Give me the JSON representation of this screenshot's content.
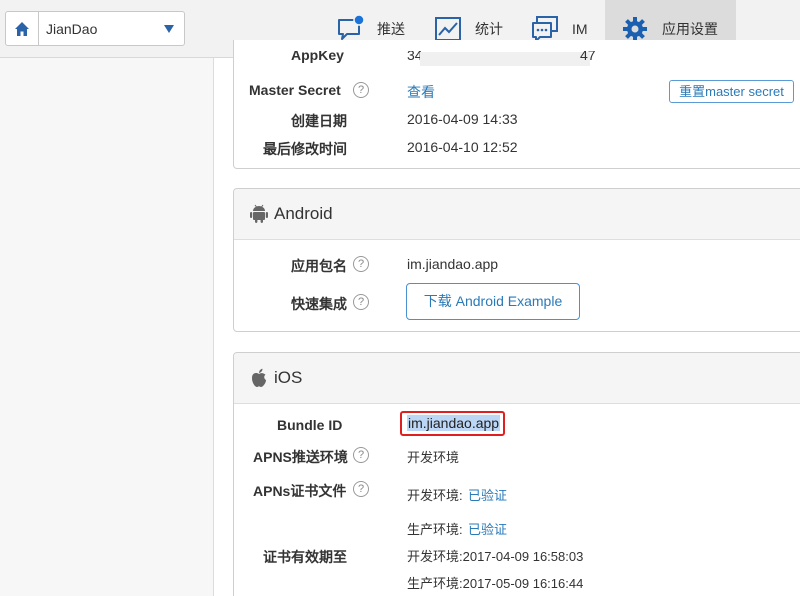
{
  "app_selector": {
    "app_name": "JianDao"
  },
  "nav": {
    "push": "推送",
    "stats": "统计",
    "im": "IM",
    "settings": "应用设置"
  },
  "app_info": {
    "appkey_label": "AppKey",
    "appkey_prefix": "34",
    "appkey_suffix": "47",
    "master_secret_label": "Master Secret",
    "master_secret_view": "查看",
    "reset_button": "重置master secret",
    "created_label": "创建日期",
    "created_value": "2016-04-09 14:33",
    "modified_label": "最后修改时间",
    "modified_value": "2016-04-10 12:52"
  },
  "android": {
    "title": "Android",
    "package_label": "应用包名",
    "package_value": "im.jiandao.app",
    "quick_label": "快速集成",
    "download_button": "下载 Android Example"
  },
  "ios": {
    "title": "iOS",
    "bundle_label": "Bundle ID",
    "bundle_value": "im.jiandao.app",
    "apns_env_label": "APNS推送环境",
    "apns_env_value": "开发环境",
    "cert_label": "APNs证书文件",
    "dev_env": "开发环境:",
    "dev_status": "已验证",
    "prod_env": "生产环境:",
    "prod_status": "已验证",
    "expiry_label": "证书有效期至",
    "dev_expiry": "开发环境:2017-04-09 16:58:03",
    "prod_expiry": "生产环境:2017-05-09 16:16:44"
  },
  "help_glyph": "?",
  "colors": {
    "link": "#2a7ab8",
    "highlight_border": "#e02020",
    "selection": "#bcd6f5",
    "nav_active": "#dcdcdc"
  }
}
